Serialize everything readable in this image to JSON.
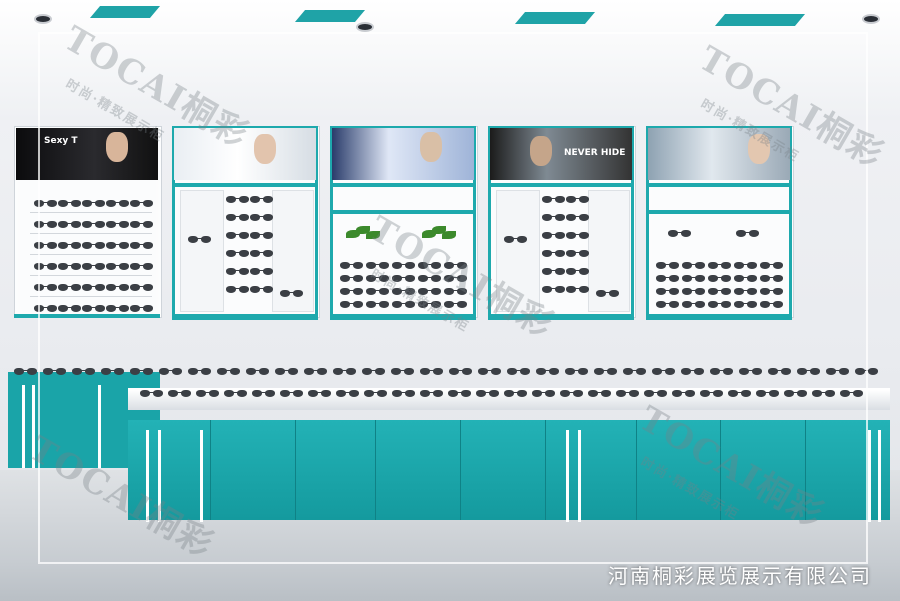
{
  "scene": {
    "description_tag": "eyewear-store-interior",
    "watermark": {
      "main": "TOCAI",
      "chinese": "桐彩",
      "tagline": "时尚·精致展示柜"
    },
    "caption": "河南桐彩展览展示有限公司"
  },
  "banners": [
    {
      "text": "Sexy T",
      "text2": ""
    },
    {
      "text": "",
      "text2": ""
    },
    {
      "text": "",
      "text2": ""
    },
    {
      "text": "NEVER HIDE",
      "text2": ""
    },
    {
      "text": "",
      "text2": ""
    }
  ],
  "colors": {
    "teal": "#1ea9ad",
    "wall": "#eef0f3",
    "white": "#ffffff"
  }
}
